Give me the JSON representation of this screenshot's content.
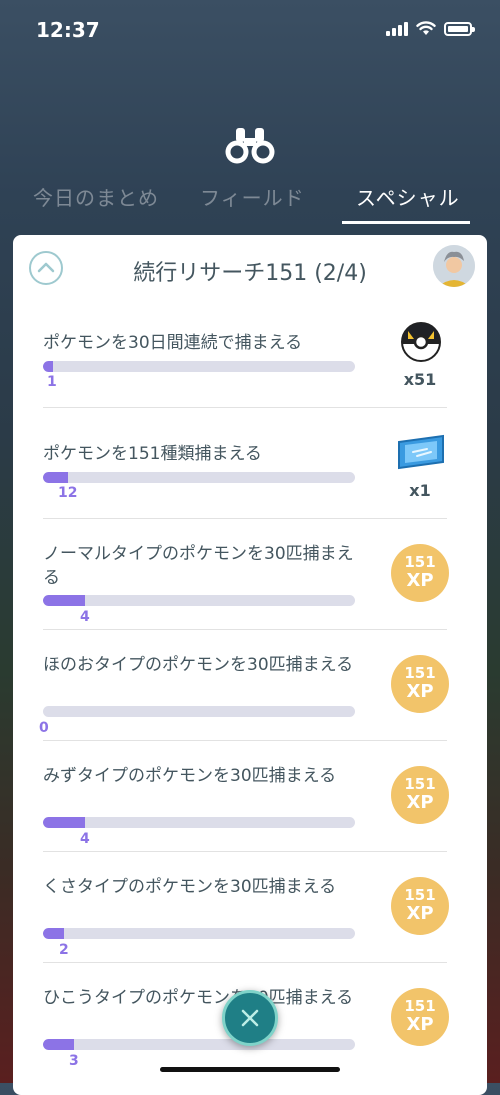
{
  "status": {
    "time": "12:37"
  },
  "tabs": [
    {
      "label": "今日のまとめ",
      "active": false
    },
    {
      "label": "フィールド",
      "active": false
    },
    {
      "label": "スペシャル",
      "active": true
    }
  ],
  "card": {
    "title": "続行リサーチ151 (2/4)"
  },
  "tasks": [
    {
      "text": "ポケモンを30日間連続で捕まえる",
      "progress": 1,
      "goal": 30,
      "count": "1",
      "reward": {
        "type": "ultra-ball",
        "qty": "x51"
      }
    },
    {
      "text": "ポケモンを151種類捕まえる",
      "progress": 12,
      "goal": 151,
      "count": "12",
      "reward": {
        "type": "lucky-pass",
        "qty": "x1"
      }
    },
    {
      "text": "ノーマルタイプのポケモンを30匹捕まえる",
      "progress": 4,
      "goal": 30,
      "count": "4",
      "reward": {
        "type": "xp",
        "xp_value": "151",
        "xp_label": "XP"
      }
    },
    {
      "text": "ほのおタイプのポケモンを30匹捕まえる",
      "progress": 0,
      "goal": 30,
      "count": "0",
      "reward": {
        "type": "xp",
        "xp_value": "151",
        "xp_label": "XP"
      }
    },
    {
      "text": "みずタイプのポケモンを30匹捕まえる",
      "progress": 4,
      "goal": 30,
      "count": "4",
      "reward": {
        "type": "xp",
        "xp_value": "151",
        "xp_label": "XP"
      }
    },
    {
      "text": "くさタイプのポケモンを30匹捕まえる",
      "progress": 2,
      "goal": 30,
      "count": "2",
      "reward": {
        "type": "xp",
        "xp_value": "151",
        "xp_label": "XP"
      }
    },
    {
      "text": "ひこうタイプのポケモンを30匹捕まえる",
      "progress": 3,
      "goal": 30,
      "count": "3",
      "reward": {
        "type": "xp",
        "xp_value": "151",
        "xp_label": "XP"
      }
    }
  ],
  "colors": {
    "accent": "#8c73e6",
    "track": "#dcdde9",
    "xp": "#f2c46a",
    "text": "#44565f"
  }
}
